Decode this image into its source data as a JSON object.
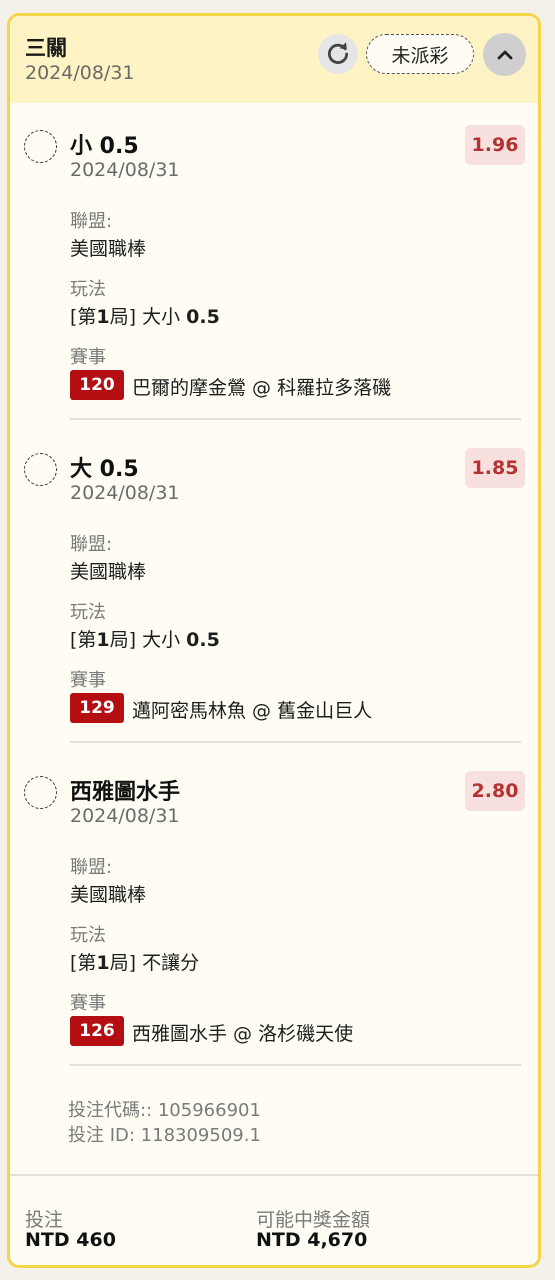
{
  "header": {
    "title": "三關",
    "date": "2024/08/31",
    "status": "未派彩"
  },
  "bets": [
    {
      "selection": "小 0.5",
      "date": "2024/08/31",
      "odds": "1.96",
      "league_label": "聯盟:",
      "league": "美國職棒",
      "market_label": "玩法",
      "market_prefix": "[第",
      "market_period": "1",
      "market_mid": "局] 大小 ",
      "market_line": "0.5",
      "event_label": "賽事",
      "event_no": "120",
      "event": "巴爾的摩金鶯 @ 科羅拉多落磯"
    },
    {
      "selection": "大 0.5",
      "date": "2024/08/31",
      "odds": "1.85",
      "league_label": "聯盟:",
      "league": "美國職棒",
      "market_label": "玩法",
      "market_prefix": "[第",
      "market_period": "1",
      "market_mid": "局] 大小 ",
      "market_line": "0.5",
      "event_label": "賽事",
      "event_no": "129",
      "event": "邁阿密馬林魚 @ 舊金山巨人"
    },
    {
      "selection": "西雅圖水手",
      "date": "2024/08/31",
      "odds": "2.80",
      "league_label": "聯盟:",
      "league": "美國職棒",
      "market_label": "玩法",
      "market_prefix": "[第",
      "market_period": "1",
      "market_mid": "局] 不讓分",
      "market_line": "",
      "event_label": "賽事",
      "event_no": "126",
      "event": "西雅圖水手 @ 洛杉磯天使"
    }
  ],
  "bet_code": "投注代碼:: 105966901",
  "bet_id": "投注 ID: 118309509.1",
  "footer": {
    "stake_label": "投注",
    "stake_value": "NTD 460",
    "payout_label": "可能中獎金額",
    "payout_value": "NTD 4,670"
  },
  "colors": {
    "card_border": "#f3d54a",
    "header_bg": "#fdf3c4",
    "odds_text": "#b53232",
    "badge_bg": "#b50e12"
  },
  "icons": [
    "refresh-icon",
    "chevron-up-icon"
  ]
}
